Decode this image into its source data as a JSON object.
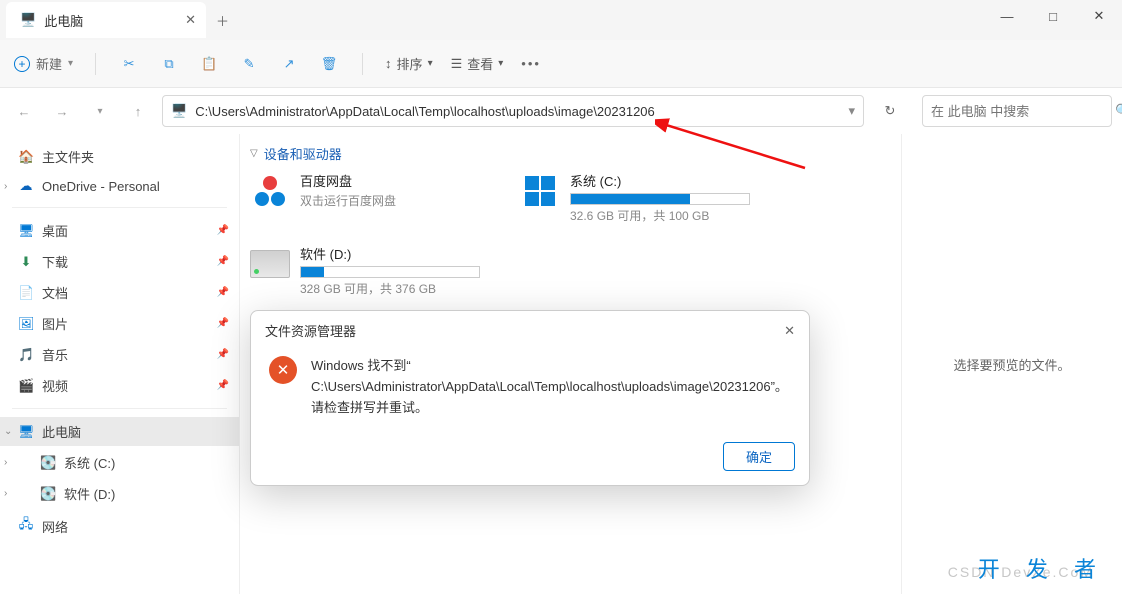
{
  "tab": {
    "title": "此电脑"
  },
  "toolbar": {
    "new": "新建",
    "sort": "排序",
    "view": "查看"
  },
  "address": {
    "path": "C:\\Users\\Administrator\\AppData\\Local\\Temp\\localhost\\uploads\\image\\20231206"
  },
  "search": {
    "placeholder": "在 此电脑 中搜索"
  },
  "sidebar": {
    "home": "主文件夹",
    "onedrive": "OneDrive - Personal",
    "desktop": "桌面",
    "downloads": "下载",
    "documents": "文档",
    "pictures": "图片",
    "music": "音乐",
    "videos": "视频",
    "thispc": "此电脑",
    "drive_c": "系统 (C:)",
    "drive_d": "软件 (D:)",
    "network": "网络"
  },
  "section": {
    "header": "设备和驱动器"
  },
  "devices": {
    "baidu": {
      "title": "百度网盘",
      "sub": "双击运行百度网盘"
    },
    "c": {
      "title": "系统 (C:)",
      "sub": "32.6 GB 可用，共 100 GB",
      "fill_pct": 67
    },
    "d": {
      "title": "软件 (D:)",
      "sub": "328 GB 可用，共 376 GB",
      "fill_pct": 13
    }
  },
  "preview": {
    "text": "选择要预览的文件。"
  },
  "dialog": {
    "title": "文件资源管理器",
    "line1": "Windows 找不到“",
    "line2": "C:\\Users\\Administrator\\AppData\\Local\\Temp\\localhost\\uploads\\image\\20231206”。",
    "line3": "请检查拼写并重试。",
    "ok": "确定"
  },
  "watermark": {
    "brand": "开 发 者",
    "sub": "CSDN DevZe.CoM"
  }
}
